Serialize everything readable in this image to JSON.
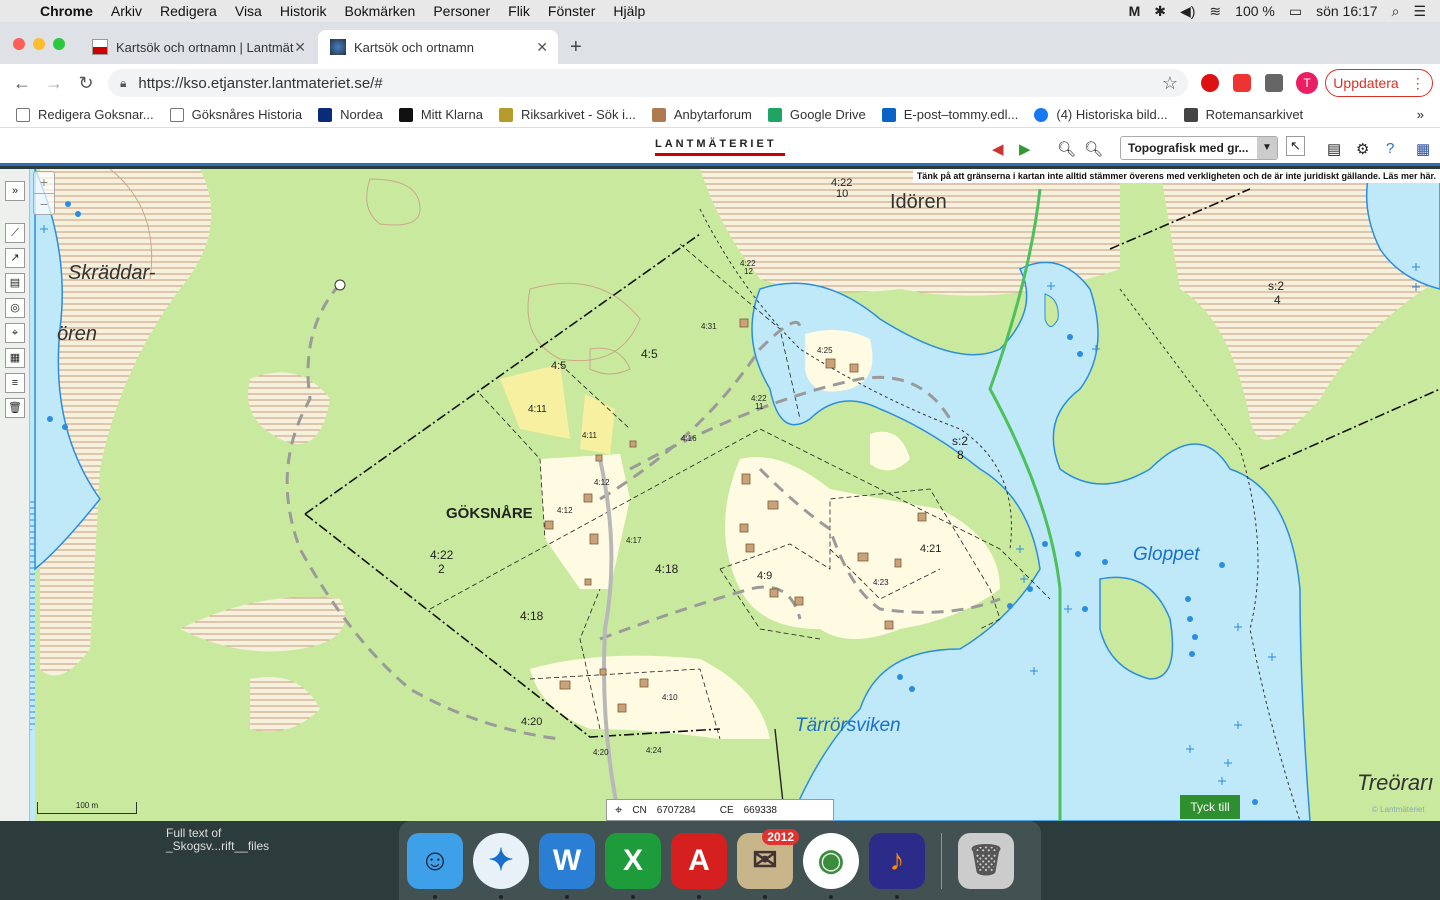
{
  "menubar": {
    "app": "Chrome",
    "items": [
      "Arkiv",
      "Redigera",
      "Visa",
      "Historik",
      "Bokmärken",
      "Personer",
      "Flik",
      "Fönster",
      "Hjälp"
    ],
    "battery": "100 %",
    "clock": "sön 16:17"
  },
  "tabs": [
    {
      "title": "Kartsök och ortnamn | Lantmät",
      "active": false
    },
    {
      "title": "Kartsök och ortnamn",
      "active": true
    }
  ],
  "toolbar": {
    "url": "https://kso.etjanster.lantmateriet.se/#",
    "profile_initial": "T",
    "update_label": "Uppdatera"
  },
  "bookmarks": [
    {
      "label": "Redigera Goksnar...",
      "icon": "g-icon",
      "color": "#777"
    },
    {
      "label": "Göksnåres Historia",
      "icon": "g-icon",
      "color": "#777"
    },
    {
      "label": "Nordea",
      "icon": "nordea-icon",
      "color": "#0a2a7a"
    },
    {
      "label": "Mitt Klarna",
      "icon": "klarna-icon",
      "color": "#111"
    },
    {
      "label": "Riksarkivet - Sök i...",
      "icon": "riksarkivet-icon",
      "color": "#b59b2a"
    },
    {
      "label": "Anbytarforum",
      "icon": "anbytarforum-icon",
      "color": "#b07a50"
    },
    {
      "label": "Google Drive",
      "icon": "drive-icon",
      "color": "#1fa463"
    },
    {
      "label": "E-post–tommy.edl...",
      "icon": "outlook-icon",
      "color": "#0a64c8"
    },
    {
      "label": "(4) Historiska bild...",
      "icon": "facebook-icon",
      "color": "#1877f2"
    },
    {
      "label": "Rotemansarkivet",
      "icon": "shield-icon",
      "color": "#444"
    }
  ],
  "app": {
    "logo": "LANTMÄTERIET",
    "map_type": "Topografisk med gr...",
    "disclaimer": "Tänk på att gränserna i kartan inte alltid stämmer överens med verkligheten och de är inte juridiskt gällande. Läs mer här."
  },
  "map": {
    "places": [
      {
        "name": "Skräddar-",
        "style": "place"
      },
      {
        "name": "ören",
        "style": "place"
      },
      {
        "name": "Idören",
        "style": "place"
      },
      {
        "name": "GÖKSNÅRE",
        "style": "village"
      },
      {
        "name": "Gloppet",
        "style": "water"
      },
      {
        "name": "Tärrörsviken",
        "style": "water"
      },
      {
        "name": "Treörarı",
        "style": "place"
      }
    ],
    "parcels": [
      "4:22",
      "10",
      "4:22",
      "12",
      "4:31",
      "4:25",
      "4:5",
      "4:5",
      "4:11",
      "4:11",
      "4:16",
      "4:22",
      "11",
      "s:2",
      "8",
      "s:2",
      "4",
      "4:12",
      "4:12",
      "4:17",
      "4:22",
      "2",
      "4:18",
      "4:18",
      "4:9",
      "4:21",
      "4:23",
      "4:10",
      "4:20",
      "4:20",
      "4:24"
    ],
    "scale_label": "100 m",
    "coords": {
      "cn_label": "CN",
      "cn_value": "6707284",
      "ce_label": "CE",
      "ce_value": "669338"
    },
    "feedback_label": "Tyck till",
    "copyright": "© Lantmäteriet"
  },
  "desktop": {
    "label_line1": "Full text of",
    "label_line2": "_Skogsv...rift__files"
  },
  "dock": {
    "apps": [
      {
        "name": "finder-icon",
        "glyph": "☺",
        "bg": "#3ea0e8"
      },
      {
        "name": "safari-icon",
        "glyph": "✦",
        "bg": "#e8f0f8"
      },
      {
        "name": "word-icon",
        "glyph": "W",
        "bg": "#2a7fd4"
      },
      {
        "name": "excel-icon",
        "glyph": "X",
        "bg": "#1e9b3a"
      },
      {
        "name": "acrobat-icon",
        "glyph": "A",
        "bg": "#d61f1f"
      },
      {
        "name": "mail-icon",
        "glyph": "✉",
        "bg": "#c9b58a",
        "badge": "2012"
      },
      {
        "name": "chrome-icon",
        "glyph": "◉",
        "bg": "#ffffff"
      },
      {
        "name": "audacity-icon",
        "glyph": "♪",
        "bg": "#2b2b8a"
      }
    ],
    "trash": "trash-icon"
  }
}
